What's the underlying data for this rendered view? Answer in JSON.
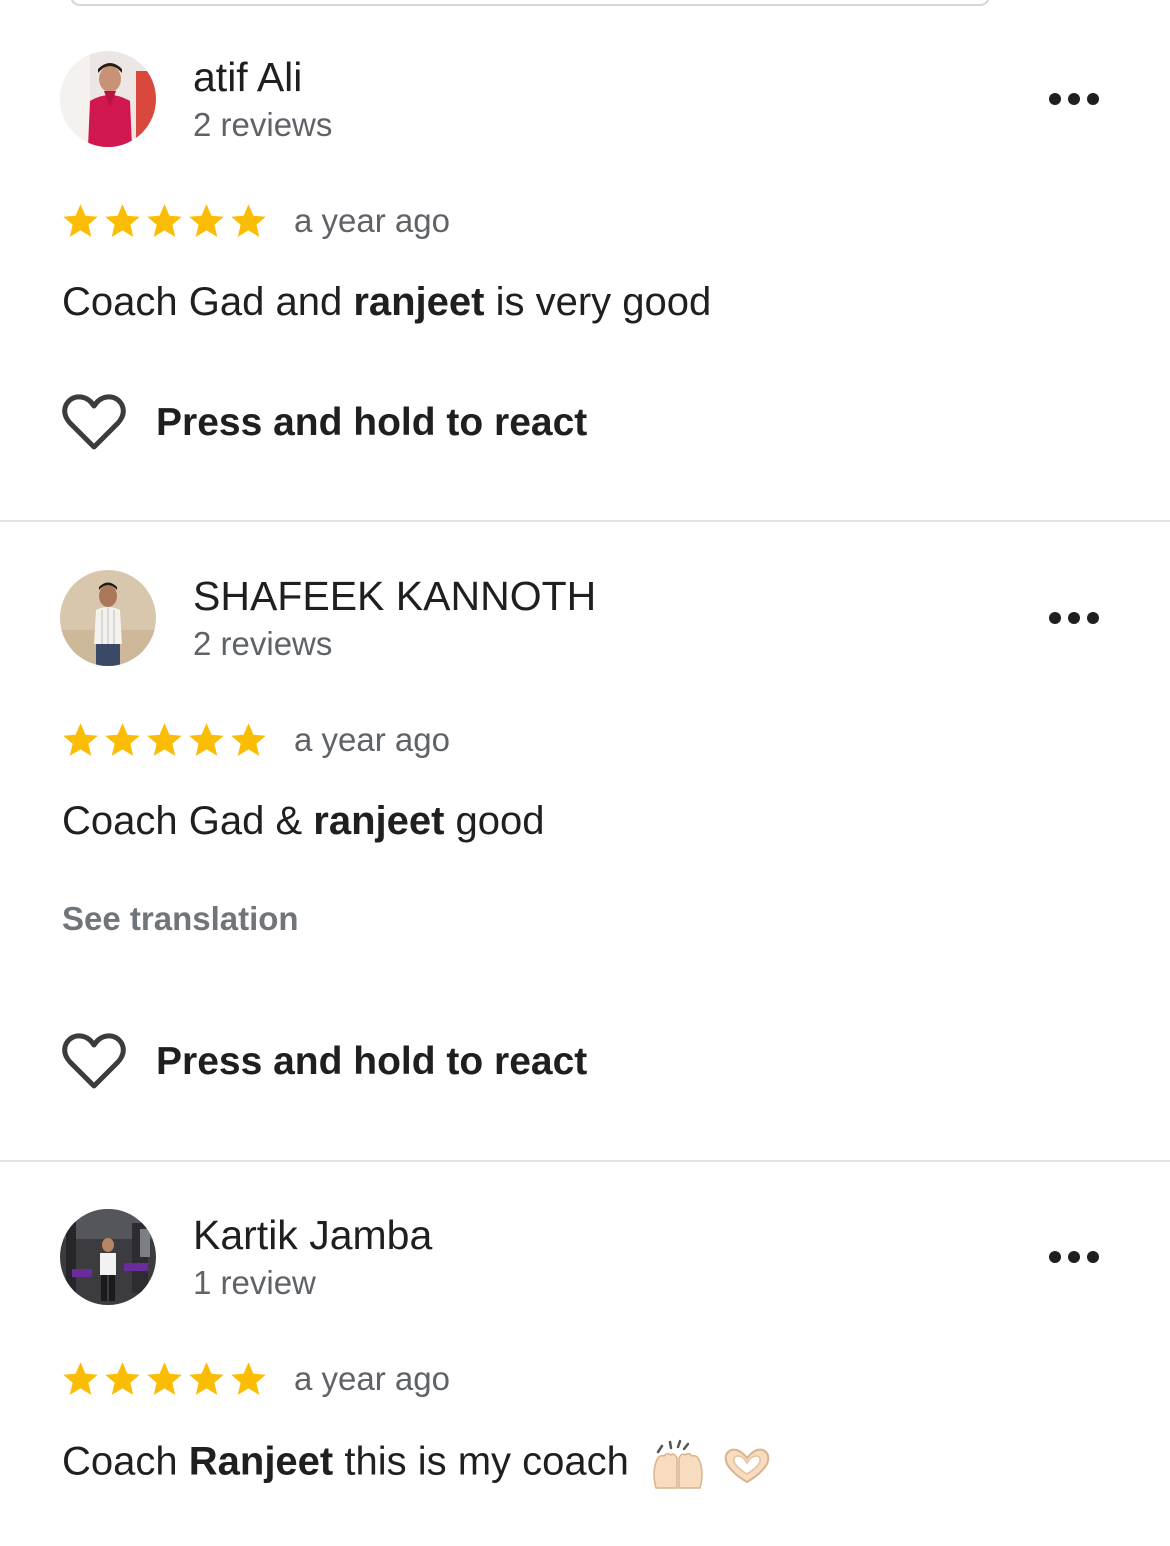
{
  "reviews": [
    {
      "author": "atif Ali",
      "review_count": "2 reviews",
      "rating": 5,
      "time": "a year ago",
      "text_parts": [
        "Coach Gad and ",
        "ranjeet",
        " is very good"
      ],
      "react_label": "Press and hold to react",
      "avatar_icon": "person-red-shirt-avatar"
    },
    {
      "author": "SHAFEEK KANNOTH",
      "review_count": "2 reviews",
      "rating": 5,
      "time": "a year ago",
      "text_parts": [
        "Coach Gad & ",
        "ranjeet",
        " good"
      ],
      "translation_label": "See translation",
      "react_label": "Press and hold to react",
      "avatar_icon": "person-white-shirt-avatar"
    },
    {
      "author": "Kartik Jamba",
      "review_count": "1 review",
      "rating": 5,
      "time": "a year ago",
      "text_parts": [
        "Coach ",
        "Ranjeet",
        " this is my coach"
      ],
      "emojis": [
        "raising-hands-emoji",
        "heart-hands-emoji"
      ],
      "avatar_icon": "person-gym-avatar"
    }
  ],
  "colors": {
    "star": "#fbbc04",
    "secondary_text": "#5f6368",
    "divider": "#e3e3e3"
  }
}
